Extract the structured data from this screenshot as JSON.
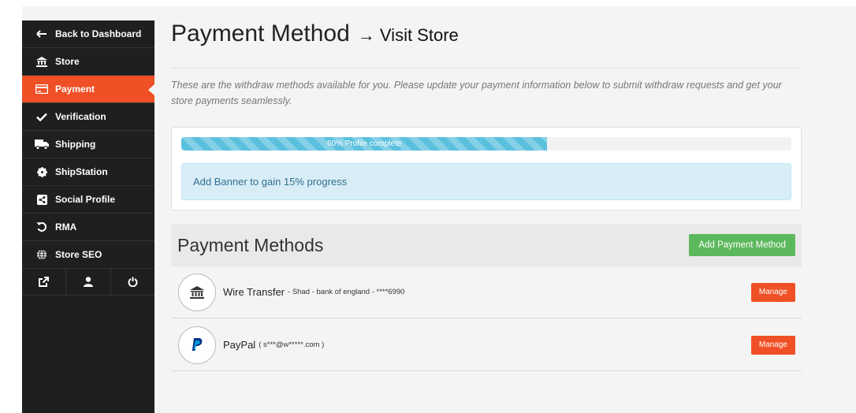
{
  "sidebar": {
    "items": [
      {
        "label": "Back to Dashboard",
        "icon": "arrow-left-icon"
      },
      {
        "label": "Store",
        "icon": "bank-icon"
      },
      {
        "label": "Payment",
        "icon": "credit-card-icon",
        "active": true
      },
      {
        "label": "Verification",
        "icon": "check-icon"
      },
      {
        "label": "Shipping",
        "icon": "truck-icon"
      },
      {
        "label": "ShipStation",
        "icon": "gear-icon"
      },
      {
        "label": "Social Profile",
        "icon": "share-icon"
      },
      {
        "label": "RMA",
        "icon": "undo-icon"
      },
      {
        "label": "Store SEO",
        "icon": "globe-icon"
      }
    ],
    "footer_icons": [
      "external-link-icon",
      "user-icon",
      "power-icon"
    ],
    "active_color": "#f05025"
  },
  "header": {
    "title": "Payment Method",
    "link": "→ Visit Store",
    "description": "These are the withdraw methods available for you. Please update your payment information below to submit withdraw requests and get your store payments seamlessly."
  },
  "progress": {
    "percent": 60,
    "label": "60% Profile complete",
    "hint": "Add Banner to gain 15% progress"
  },
  "payment_methods": {
    "heading": "Payment Methods",
    "add_button": "Add Payment Method",
    "rows": [
      {
        "name": "Wire Transfer",
        "detail": "- Shad - bank of england - ****6990",
        "icon": "bank-icon",
        "button": "Manage"
      },
      {
        "name": "PayPal",
        "detail": "( s***@w*****.com )",
        "icon": "paypal-icon",
        "button": "Manage"
      }
    ]
  }
}
